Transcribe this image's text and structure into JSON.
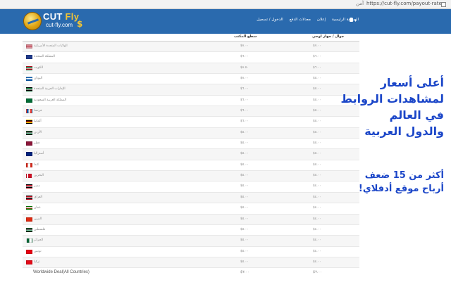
{
  "browser": {
    "url": "https://cut-fly.com/payout-rates",
    "secure_label": "آمن"
  },
  "logo": {
    "brand_main": "CUT",
    "brand_accent": "Fly",
    "sub": "cut-fly.com"
  },
  "nav": {
    "items": [
      "الصفحة الرئيسية",
      "إعلان",
      "معدلات الدفع",
      "الدخول / تسجيل"
    ]
  },
  "table": {
    "header_desktop": "جوال / جهاز لوحي",
    "header_mobile": "سطح المكتب",
    "rows": [
      {
        "flag": "us",
        "name": "الولايات المتحدة الأمريكية",
        "mobile": "$٧.٠٠",
        "desktop": "$٧.٠٠"
      },
      {
        "flag": "gb",
        "name": "المملكة المتحدة",
        "mobile": "$٦.٠٠",
        "desktop": "$٦.٠٠"
      },
      {
        "flag": "kw",
        "name": "الكويت",
        "mobile": "$٧.٥٠",
        "desktop": "$٦.٠٠"
      },
      {
        "flag": "gr",
        "name": "اليونان",
        "mobile": "$٧.٠٠",
        "desktop": "$٥.٠٠"
      },
      {
        "flag": "ae",
        "name": "الإمارات العربية المتحدة",
        "mobile": "$٦.٠٠",
        "desktop": "$٥.٠٠"
      },
      {
        "flag": "sa",
        "name": "المملكة العربية السعودية",
        "mobile": "$٦.٠٠",
        "desktop": "$٥.٠٠"
      },
      {
        "flag": "fr",
        "name": "فرنسا",
        "mobile": "$٦.٠٠",
        "desktop": "$٥.٠٠"
      },
      {
        "flag": "de",
        "name": "ألمانيا",
        "mobile": "$٦.٠٠",
        "desktop": "$٥.٠٠"
      },
      {
        "flag": "jo",
        "name": "الأردن",
        "mobile": "$٥.٠٠",
        "desktop": "$٥.٠٠"
      },
      {
        "flag": "qa",
        "name": "قطر",
        "mobile": "$٥.٠٠",
        "desktop": "$٥.٠٠"
      },
      {
        "flag": "au",
        "name": "أستراليا",
        "mobile": "$٥.٠٠",
        "desktop": "$٥.٠٠"
      },
      {
        "flag": "ca",
        "name": "كندا",
        "mobile": "$٥.٠٠",
        "desktop": "$٥.٠٠"
      },
      {
        "flag": "bh",
        "name": "البحرين",
        "mobile": "$٥.٠٠",
        "desktop": "$٥.٠٠"
      },
      {
        "flag": "eg",
        "name": "مصر",
        "mobile": "$٥.٠٠",
        "desktop": "$٤.٠٠"
      },
      {
        "flag": "iq",
        "name": "العراق",
        "mobile": "$٥.٠٠",
        "desktop": "$٤.٠٠"
      },
      {
        "flag": "om",
        "name": "عمان",
        "mobile": "$٥.٠٠",
        "desktop": "$٤.٠٠"
      },
      {
        "flag": "cn",
        "name": "الصين",
        "mobile": "$٥.٠٠",
        "desktop": "$٤.٠٠"
      },
      {
        "flag": "ps",
        "name": "فلسطين",
        "mobile": "$٥.٠٠",
        "desktop": "$٤.٠٠"
      },
      {
        "flag": "dz",
        "name": "الجزائر",
        "mobile": "$٥.٠٠",
        "desktop": "$٤.٠٠"
      },
      {
        "flag": "tn",
        "name": "تونس",
        "mobile": "$٥.٠٠",
        "desktop": "$٤.٠٠"
      },
      {
        "flag": "tr",
        "name": "تركيا",
        "mobile": "$٥.٠٠",
        "desktop": "$٤.٠٠"
      },
      {
        "flag": "",
        "name": "Worldwide Deal(All Countries)",
        "mobile": "$٣.٠٠",
        "desktop": "$٣.٠٠"
      }
    ]
  },
  "promo": {
    "line1": "أعلى أسعار",
    "line2": "لمشاهدات الروابط",
    "line3": "في العالم",
    "line4": "والدول العربية",
    "line5": "أكثر من 15 ضعف",
    "line6": "أرباح موقع أدفلاي!"
  },
  "flag_colors": {
    "us": "linear-gradient(180deg,#b22234 0 15%,#fff 15% 30%,#b22234 30% 45%,#fff 45% 60%,#b22234 60% 75%,#fff 75% 90%,#b22234 90%)",
    "gb": "#1f3a8a",
    "kw": "linear-gradient(180deg,#007a3d 0 33%,#fff 33% 66%,#ce1126 66%)",
    "gr": "repeating-linear-gradient(180deg,#0d5eaf 0 1.1px,#fff 1.1px 2.2px)",
    "ae": "linear-gradient(180deg,#00732f 0 33%,#fff 33% 66%,#000 66%)",
    "sa": "#006c35",
    "fr": "linear-gradient(90deg,#0055a4 0 33%,#fff 33% 66%,#ef4135 66%)",
    "de": "linear-gradient(180deg,#000 0 33%,#dd0000 33% 66%,#ffce00 66%)",
    "jo": "linear-gradient(180deg,#000 0 33%,#fff 33% 66%,#007a3d 66%)",
    "qa": "#8a1538",
    "au": "#00247d",
    "ca": "linear-gradient(90deg,#d52b1e 0 25%,#fff 25% 75%,#d52b1e 75%)",
    "bh": "linear-gradient(90deg,#fff 0 30%,#ce1126 30%)",
    "eg": "linear-gradient(180deg,#ce1126 0 33%,#fff 33% 66%,#000 66%)",
    "iq": "linear-gradient(180deg,#ce1126 0 33%,#fff 33% 66%,#000 66%)",
    "om": "linear-gradient(180deg,#fff 0 33%,#db161b 33% 66%,#008000 66%)",
    "cn": "#de2910",
    "ps": "linear-gradient(180deg,#000 0 33%,#fff 33% 66%,#007a3d 66%)",
    "dz": "linear-gradient(90deg,#006233 0 50%,#fff 50%)",
    "tn": "#e70013",
    "tr": "#e30a17"
  }
}
